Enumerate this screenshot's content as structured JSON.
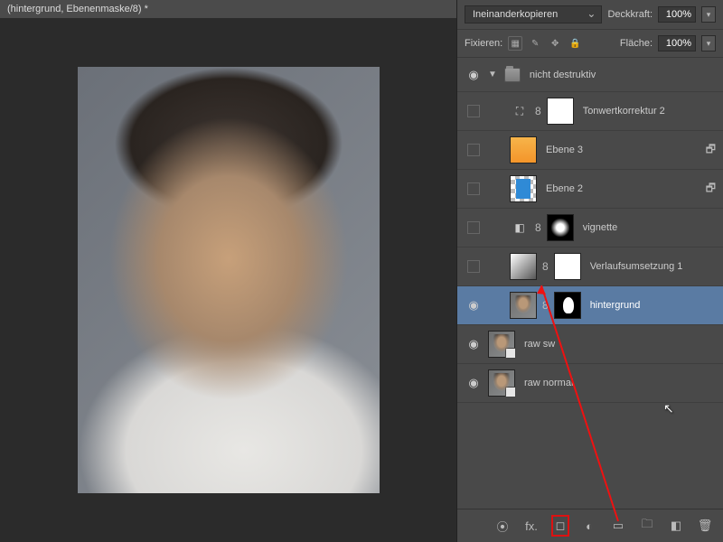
{
  "title": "(hintergrund, Ebenenmaske/8) *",
  "blend": {
    "mode": "Ineinanderkopieren",
    "opacity_label": "Deckkraft:",
    "opacity_value": "100%",
    "lock_label": "Fixieren:",
    "fill_label": "Fläche:",
    "fill_value": "100%"
  },
  "group": {
    "name": "nicht destruktiv"
  },
  "layers": [
    {
      "id": "tw",
      "name": "Tonwertkorrektur 2",
      "visible": false,
      "indent": 1,
      "thumbs": [
        "adj-levels",
        "white"
      ],
      "link": true,
      "extra": ""
    },
    {
      "id": "e3",
      "name": "Ebene 3",
      "visible": false,
      "indent": 1,
      "thumbs": [
        "orange"
      ],
      "link": false,
      "extra": "group-sym"
    },
    {
      "id": "e2",
      "name": "Ebene 2",
      "visible": false,
      "indent": 1,
      "thumbs": [
        "checker"
      ],
      "link": false,
      "extra": "group-sym"
    },
    {
      "id": "vg",
      "name": "vignette",
      "visible": false,
      "indent": 1,
      "thumbs": [
        "adj-grad",
        "mask-v"
      ],
      "link": true,
      "extra": ""
    },
    {
      "id": "vu",
      "name": "Verlaufsumsetzung 1",
      "visible": false,
      "indent": 1,
      "thumbs": [
        "grad",
        "white"
      ],
      "link": true,
      "extra": ""
    },
    {
      "id": "hg",
      "name": "hintergrund",
      "visible": true,
      "indent": 1,
      "thumbs": [
        "photo",
        "mask-black"
      ],
      "link": true,
      "extra": "",
      "selected": true
    },
    {
      "id": "rs",
      "name": "raw sw",
      "visible": true,
      "indent": 0,
      "thumbs": [
        "photo smart"
      ],
      "link": false,
      "extra": ""
    },
    {
      "id": "rn",
      "name": "raw normal",
      "visible": true,
      "indent": 0,
      "thumbs": [
        "photo smart"
      ],
      "link": false,
      "extra": ""
    }
  ],
  "bottom_icons": [
    "⦿",
    "fx.",
    "◻︎",
    "◐",
    "▭",
    "🗀",
    "◧",
    "🗑"
  ]
}
